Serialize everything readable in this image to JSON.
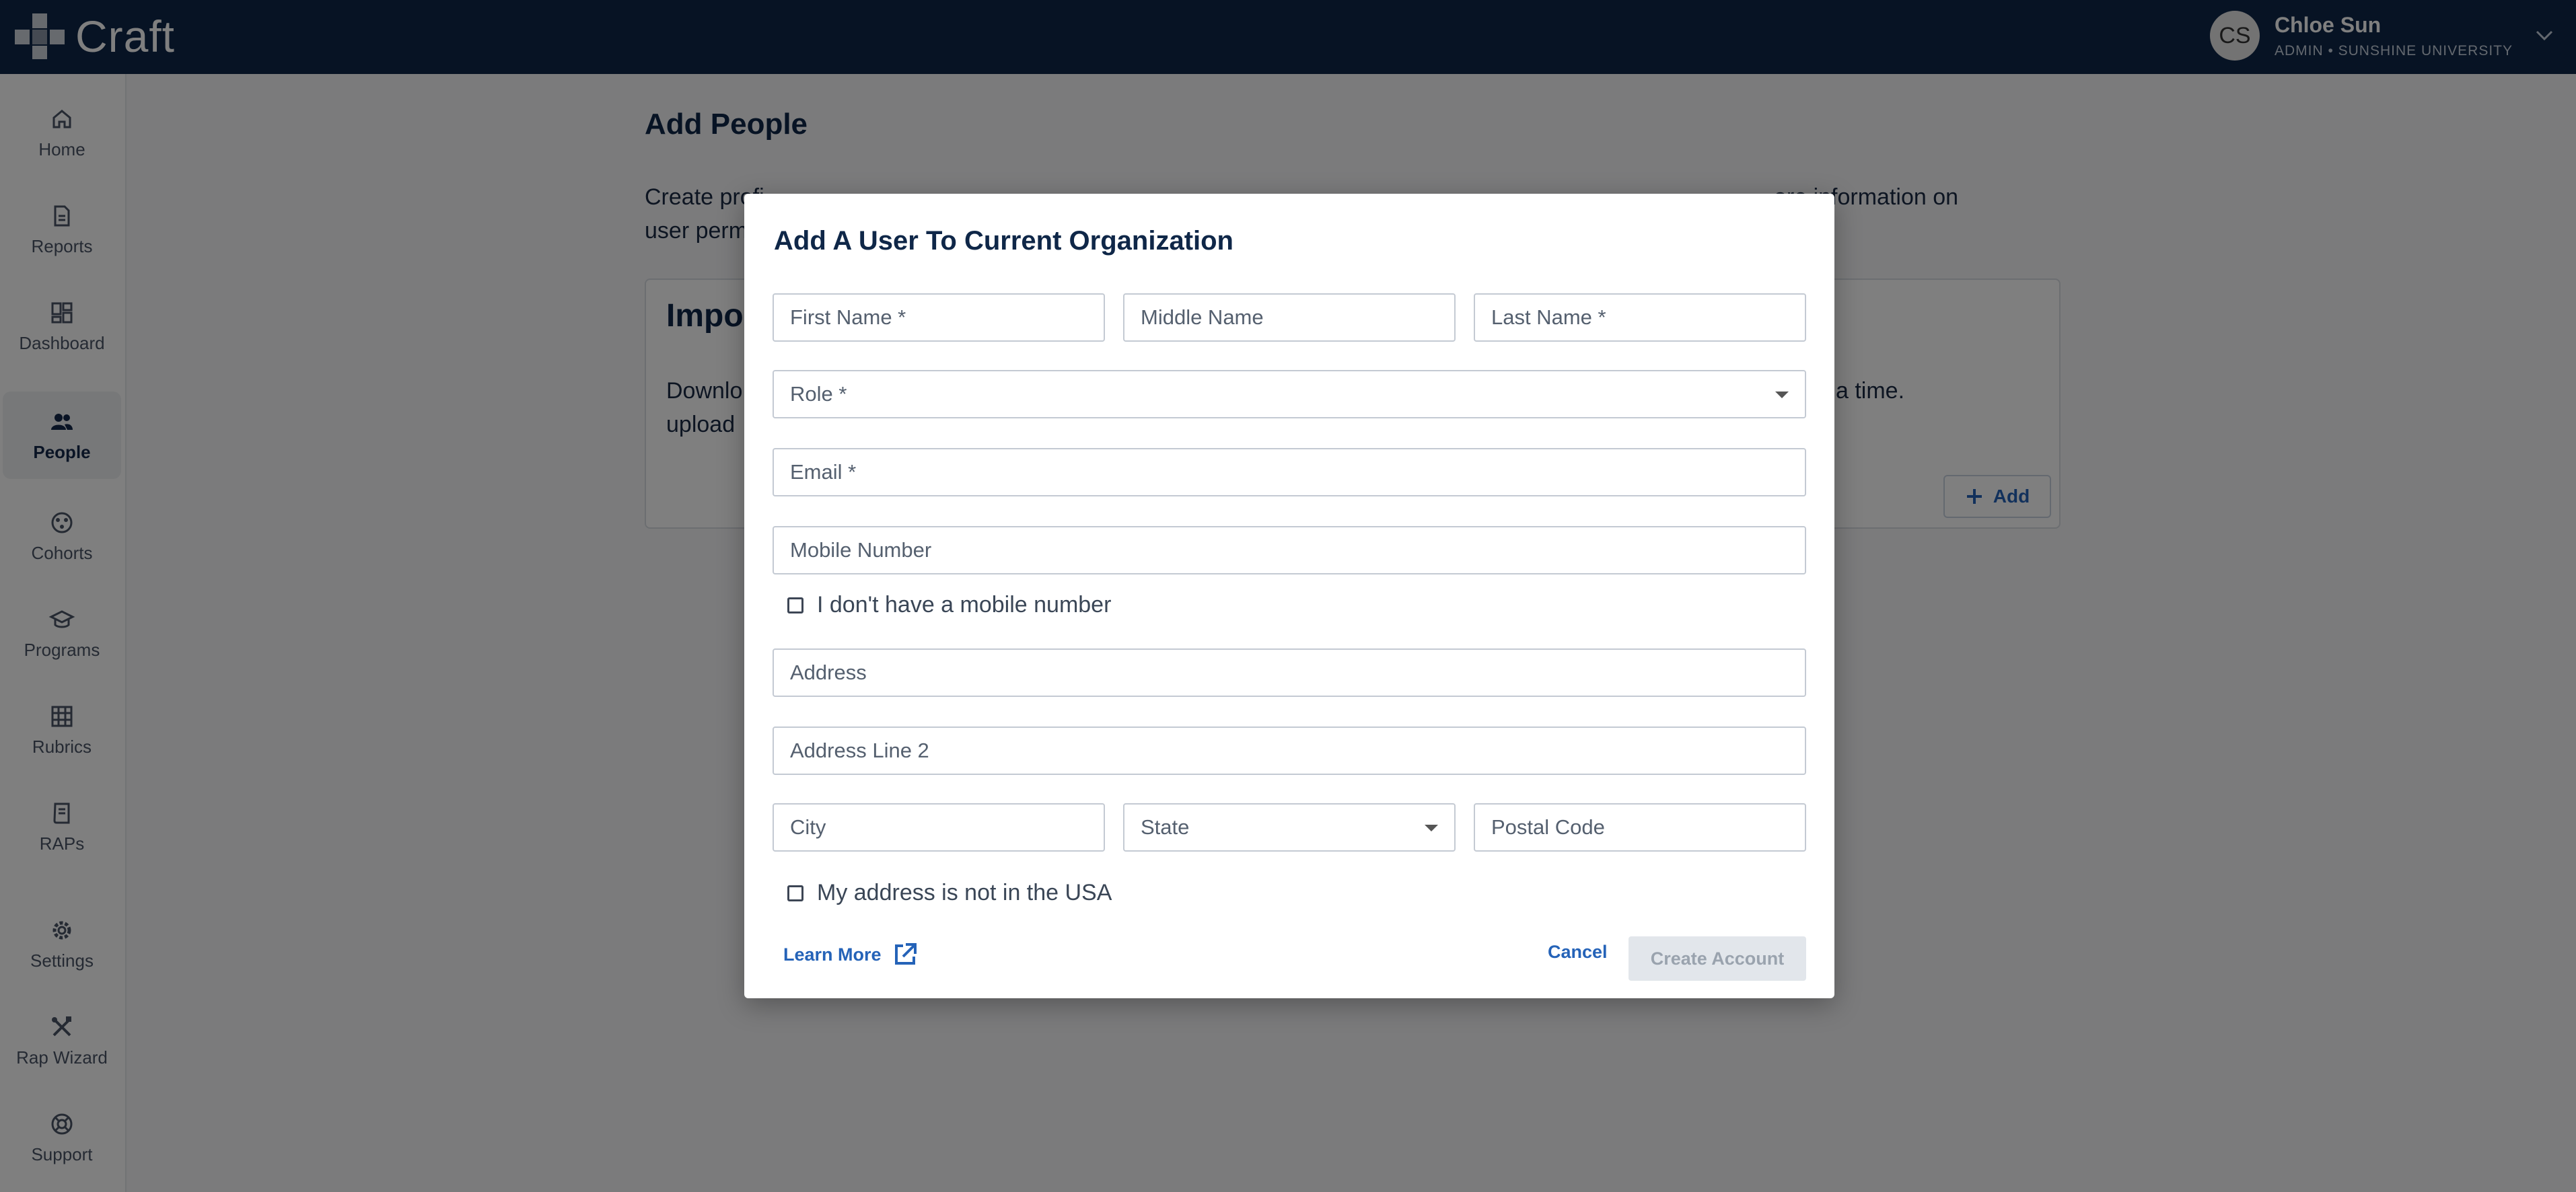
{
  "app": {
    "name": "Craft"
  },
  "user": {
    "initials": "CS",
    "name": "Chloe Sun",
    "subtitle": "ADMIN • SUNSHINE UNIVERSITY"
  },
  "sidebar": {
    "items": [
      {
        "label": "Home",
        "icon": "home-icon"
      },
      {
        "label": "Reports",
        "icon": "document-icon"
      },
      {
        "label": "Dashboard",
        "icon": "dashboard-icon"
      },
      {
        "label": "People",
        "icon": "people-icon",
        "active": true
      },
      {
        "label": "Cohorts",
        "icon": "cohorts-icon"
      },
      {
        "label": "Programs",
        "icon": "graduation-cap-icon"
      },
      {
        "label": "Rubrics",
        "icon": "grid-icon"
      },
      {
        "label": "RAPs",
        "icon": "book-icon"
      },
      {
        "label": "Settings",
        "icon": "gear-icon"
      },
      {
        "label": "Rap Wizard",
        "icon": "tools-icon"
      },
      {
        "label": "Support",
        "icon": "lifebuoy-icon"
      }
    ]
  },
  "main": {
    "title": "Add People",
    "description": "Create profi",
    "description_tail": "ore information on",
    "description_line2": "user perm",
    "import_card": {
      "title": "Impo",
      "text_line1": "Downlo",
      "text_tail": "a time.",
      "text_line2": "upload",
      "add_label": "Add"
    }
  },
  "modal": {
    "title": "Add A User To Current Organization",
    "fields": {
      "first_name": "First Name *",
      "middle_name": "Middle Name",
      "last_name": "Last Name *",
      "role": "Role *",
      "email": "Email *",
      "mobile": "Mobile Number",
      "address": "Address",
      "address2": "Address Line 2",
      "city": "City",
      "state": "State",
      "postal": "Postal Code"
    },
    "no_mobile_label": "I don't have a mobile number",
    "not_usa_label": "My address is not in the USA",
    "learn_more": "Learn More",
    "cancel": "Cancel",
    "create": "Create Account"
  },
  "colors": {
    "topbar": "#0f2748",
    "accent": "#2563b8",
    "overlay": "rgba(0,0,0,0.5)"
  }
}
